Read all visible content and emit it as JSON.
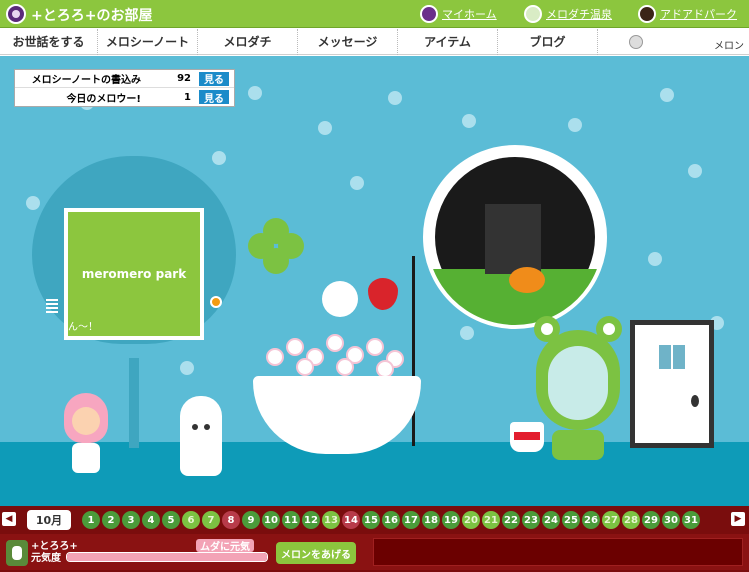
{
  "header": {
    "title": "+とろろ+のお部屋",
    "links": [
      "マイホーム",
      "メロダチ温泉",
      "アドアドパーク"
    ]
  },
  "nav": {
    "items": [
      "お世話をする",
      "メロシーノート",
      "メロダチ",
      "メッセージ",
      "アイテム",
      "ブログ"
    ],
    "melon_label": "メロン"
  },
  "stats": {
    "rows": [
      {
        "label": "メロシーノートの書込み",
        "value": "92",
        "button": "見る"
      },
      {
        "label": "今日のメロウー!",
        "value": "1",
        "button": "見る"
      }
    ]
  },
  "room": {
    "tv_screen_text": "meromero park",
    "tv_note": "ん〜！"
  },
  "calendar": {
    "month": "10月",
    "days": [
      "1",
      "2",
      "3",
      "4",
      "5",
      "6",
      "7",
      "8",
      "9",
      "10",
      "11",
      "12",
      "13",
      "14",
      "15",
      "16",
      "17",
      "18",
      "19",
      "20",
      "21",
      "22",
      "23",
      "24",
      "25",
      "26",
      "27",
      "28",
      "29",
      "30",
      "31"
    ],
    "prev_arrow": "◀",
    "next_arrow": "▶"
  },
  "status": {
    "player_name": "+とろろ+",
    "genki_label": "元気度",
    "genki_badge": "ムダに元気",
    "genki_level": 1.0,
    "melon_button": "メロンをあげる"
  },
  "colors": {
    "header_green": "#8cc63e",
    "room_blue": "#5bbcd6",
    "bar_red": "#7a0d0d"
  }
}
